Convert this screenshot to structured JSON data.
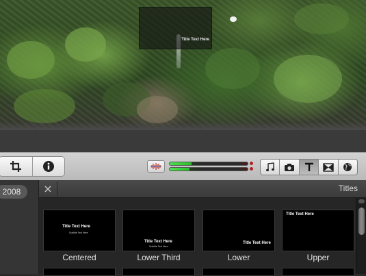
{
  "viewer": {
    "overlay_title": "Title Text Here"
  },
  "sidebar": {
    "year": "2008"
  },
  "toolbar": {
    "left_buttons": [
      "crop-icon",
      "info-icon"
    ],
    "audio_meter": {
      "left_level": 0.28,
      "right_level": 0.25
    },
    "browser_buttons": [
      "music-icon",
      "camera-icon",
      "titles-icon",
      "transitions-icon",
      "maps-icon"
    ],
    "active_browser": "titles-icon"
  },
  "panel": {
    "title": "Titles",
    "tiles": [
      {
        "label": "Centered",
        "preview_title": "Title Text Here",
        "preview_subtitle": "Subtitle Text Here"
      },
      {
        "label": "Lower Third",
        "preview_title": "Title Text Here",
        "preview_subtitle": "Subtitle Text Here"
      },
      {
        "label": "Lower",
        "preview_title": "Title Text Here"
      },
      {
        "label": "Upper",
        "preview_title": "Title Text Here"
      }
    ]
  },
  "colors": {
    "meter_green": "#4fe04f",
    "meter_red": "#b52020",
    "panel_bg": "#262626"
  }
}
